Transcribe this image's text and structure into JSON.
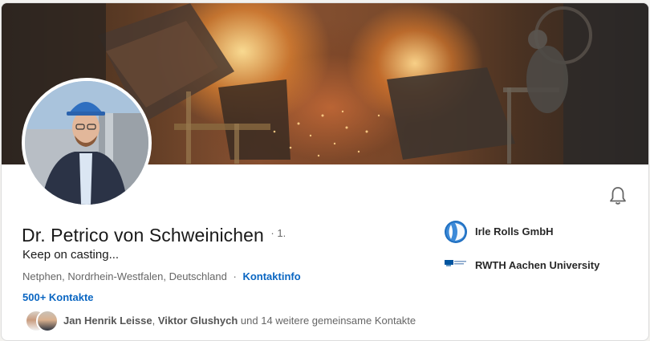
{
  "profile": {
    "name": "Dr. Petrico von Schweinichen",
    "degree": "· 1.",
    "headline": "Keep on casting...",
    "location": "Netphen, Nordrhein-Westfalen, Deutschland",
    "location_separator": "·",
    "contact_info_label": "Kontaktinfo",
    "connections_label": "500+ Kontakte"
  },
  "mutual": {
    "name1": "Jan Henrik Leisse",
    "separator": ",",
    "name2": "Viktor Glushych",
    "rest": "und 14 weitere gemeinsame Kontakte"
  },
  "experience": [
    {
      "name": "Irle Rolls GmbH",
      "logo": "irle-rolls-logo"
    },
    {
      "name": "RWTH Aachen University",
      "logo": "rwth-logo"
    }
  ],
  "icons": {
    "bell": "bell-icon"
  },
  "colors": {
    "link": "#0a66c2",
    "secondary_text": "#666666",
    "background": "#f3f2ef"
  }
}
